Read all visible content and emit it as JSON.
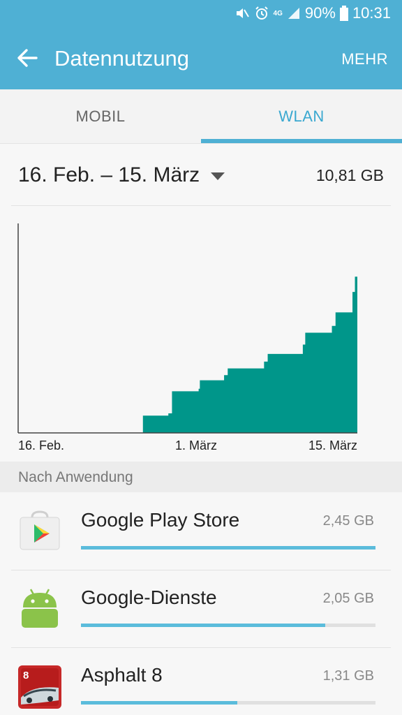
{
  "status_bar": {
    "battery": "90%",
    "time": "10:31",
    "network": "4G",
    "icons": [
      "mute-icon",
      "alarm-icon",
      "4g-icon",
      "signal-icon",
      "battery-icon"
    ]
  },
  "toolbar": {
    "title": "Datennutzung",
    "more_label": "MEHR",
    "back_icon": "arrow-left-icon"
  },
  "tabs": [
    {
      "label": "MOBIL",
      "selected": false
    },
    {
      "label": "WLAN",
      "selected": true
    }
  ],
  "period": {
    "label": "16. Feb. – 15. März",
    "total": "10,81 GB"
  },
  "chart_data": {
    "type": "area",
    "title": "",
    "xlabel": "",
    "ylabel": "",
    "x_tick_labels": [
      "16. Feb.",
      "1. März",
      "15. März"
    ],
    "x_domain": [
      0,
      28
    ],
    "x": [
      0,
      10,
      10.3,
      12.4,
      12.7,
      14.9,
      15.0,
      17.0,
      17.3,
      20.3,
      20.6,
      23.5,
      23.7,
      25.9,
      26.2,
      27.6,
      27.8,
      28
    ],
    "values": [
      0,
      0,
      1.02,
      1.15,
      2.45,
      2.6,
      3.1,
      3.4,
      3.8,
      4.2,
      4.65,
      5.2,
      5.9,
      6.3,
      7.1,
      8.3,
      9.2,
      10.81
    ],
    "series_color": "#00968a",
    "ylim": [
      0,
      12.5
    ],
    "grid": false
  },
  "section_header": "Nach Anwendung",
  "apps": [
    {
      "name": "Google Play Store",
      "size": "2,45 GB",
      "fraction": 1.0,
      "icon": "play-store-icon"
    },
    {
      "name": "Google-Dienste",
      "size": "2,05 GB",
      "fraction": 0.83,
      "icon": "android-icon"
    },
    {
      "name": "Asphalt 8",
      "size": "1,31 GB",
      "fraction": 0.53,
      "icon": "asphalt-8-icon"
    }
  ],
  "colors": {
    "accent": "#4fb0d4",
    "chart_fill": "#00968a",
    "usage_bar": "#5bbcdb"
  }
}
